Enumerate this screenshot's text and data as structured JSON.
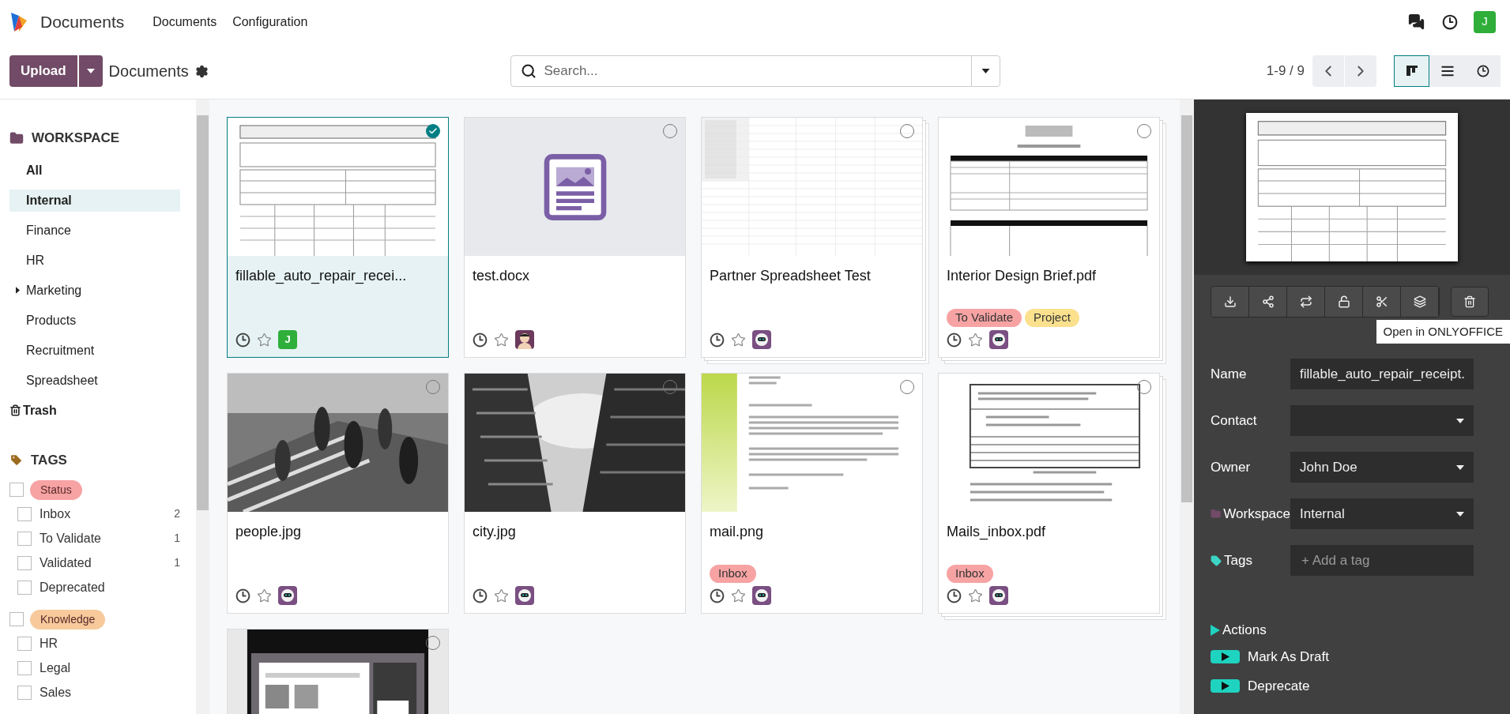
{
  "app": {
    "name": "Documents",
    "menu": [
      "Documents",
      "Configuration"
    ],
    "user_initial": "J"
  },
  "control_bar": {
    "upload": "Upload",
    "breadcrumb": "Documents",
    "search_placeholder": "Search...",
    "pager": "1-9 / 9",
    "views": [
      {
        "kind": "kanban",
        "selected": true
      },
      {
        "kind": "list",
        "selected": false
      },
      {
        "kind": "activity",
        "selected": false
      }
    ]
  },
  "sidebar": {
    "workspace_title": "WORKSPACE",
    "workspaces": [
      {
        "label": "All",
        "kind": "root",
        "selected": false
      },
      {
        "label": "Internal",
        "kind": "folder",
        "selected": true
      },
      {
        "label": "Finance",
        "kind": "folder",
        "selected": false
      },
      {
        "label": "HR",
        "kind": "folder",
        "selected": false
      },
      {
        "label": "Marketing",
        "kind": "parent",
        "selected": false
      },
      {
        "label": "Products",
        "kind": "folder",
        "selected": false
      },
      {
        "label": "Recruitment",
        "kind": "folder",
        "selected": false
      },
      {
        "label": "Spreadsheet",
        "kind": "folder",
        "selected": false
      }
    ],
    "trash": "Trash",
    "tags_title": "TAGS",
    "tag_groups": [
      {
        "label": "Status",
        "color": "#f7a3a3",
        "checked": false,
        "items": [
          {
            "label": "Inbox",
            "count": "2",
            "checked": false
          },
          {
            "label": "To Validate",
            "count": "1",
            "checked": false
          },
          {
            "label": "Validated",
            "count": "1",
            "checked": false
          },
          {
            "label": "Deprecated",
            "checked": false
          }
        ]
      },
      {
        "label": "Knowledge",
        "color": "#f7c99b",
        "checked": false,
        "items": [
          {
            "label": "HR",
            "checked": false
          },
          {
            "label": "Legal",
            "checked": false
          },
          {
            "label": "Sales",
            "checked": false
          }
        ]
      }
    ]
  },
  "cards": [
    {
      "name": "fillable_auto_repair_recei...",
      "kind": "form",
      "selected": true,
      "stacked": false,
      "avatar": {
        "kind": "letter",
        "letter": "J"
      }
    },
    {
      "name": "test.docx",
      "kind": "doc-icon",
      "selected": false,
      "stacked": false,
      "avatar": {
        "kind": "person"
      }
    },
    {
      "name": "Partner Spreadsheet Test",
      "kind": "sheet",
      "selected": false,
      "stacked": true,
      "avatar": {
        "kind": "robot"
      }
    },
    {
      "name": "Interior Design Brief.pdf",
      "kind": "brief",
      "selected": false,
      "stacked": true,
      "tags": [
        {
          "label": "To Validate",
          "color": "#f7a3a3"
        },
        {
          "label": "Project",
          "color": "#fbe18e"
        }
      ],
      "avatar": {
        "kind": "robot"
      }
    },
    {
      "name": "people.jpg",
      "kind": "people",
      "selected": false,
      "stacked": false,
      "avatar": {
        "kind": "robot"
      }
    },
    {
      "name": "city.jpg",
      "kind": "city",
      "selected": false,
      "stacked": false,
      "avatar": {
        "kind": "robot"
      }
    },
    {
      "name": "mail.png",
      "kind": "letter",
      "selected": false,
      "stacked": false,
      "tags": [
        {
          "label": "Inbox",
          "color": "#f7a3a3"
        }
      ],
      "avatar": {
        "kind": "robot"
      }
    },
    {
      "name": "Mails_inbox.pdf",
      "kind": "invoice",
      "selected": false,
      "stacked": true,
      "tags": [
        {
          "label": "Inbox",
          "color": "#f7a3a3"
        }
      ],
      "avatar": {
        "kind": "robot"
      }
    },
    {
      "kind": "screenshot",
      "selected": false
    }
  ],
  "details": {
    "toolbar": [
      {
        "kind": "download"
      },
      {
        "kind": "share"
      },
      {
        "kind": "replace"
      },
      {
        "kind": "unlock"
      },
      {
        "kind": "split"
      },
      {
        "kind": "layers"
      }
    ],
    "tooltip": "Open in ONLYOFFICE",
    "fields": [
      {
        "label": "Name",
        "kind": "text",
        "value": "fillable_auto_repair_receipt."
      },
      {
        "label": "Contact",
        "kind": "select"
      },
      {
        "label": "Owner",
        "kind": "select",
        "value": "John Doe"
      },
      {
        "label": "Workspace",
        "kind": "workspace",
        "value": "Internal"
      },
      {
        "label": "Tags",
        "kind": "tags",
        "placeholder": "+ Add a tag"
      }
    ],
    "actions_title": "Actions",
    "actions": [
      "Mark As Draft",
      "Deprecate"
    ]
  }
}
